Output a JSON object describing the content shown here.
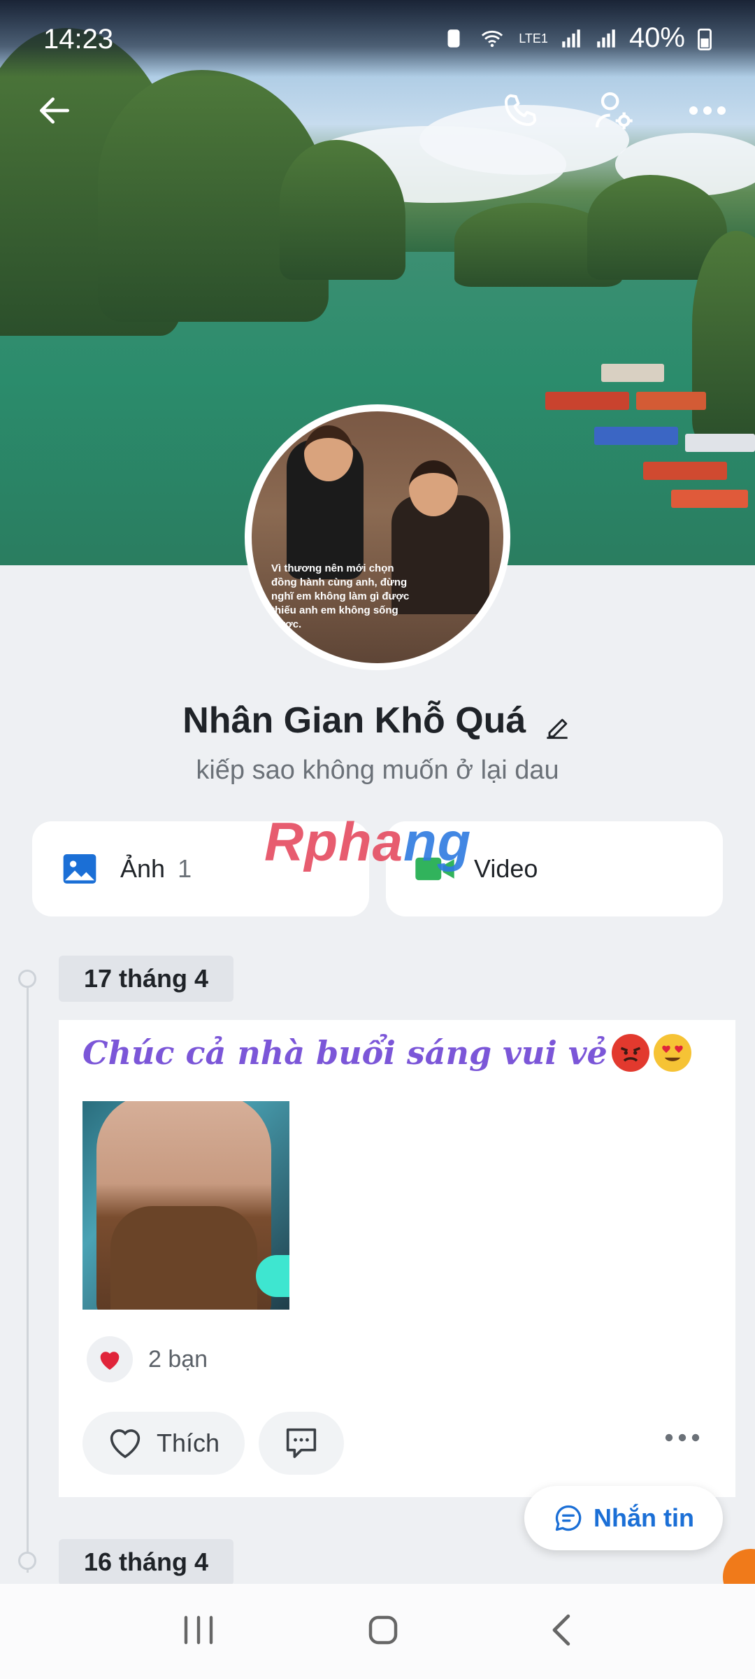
{
  "status_bar": {
    "time": "14:23",
    "network": "LTE1",
    "battery": "40%"
  },
  "header": {
    "back_icon": "arrow-left-icon",
    "call_icon": "phone-icon",
    "settings_icon": "user-settings-icon",
    "more_icon": "more-horizontal-icon"
  },
  "avatar_caption": "Vì thương nên mới chọn đồng hành cùng anh, đừng nghĩ em không làm gì được thiếu anh em không sống được.",
  "profile": {
    "name": "Nhân Gian Khỗ Quá",
    "bio": "kiếp sao không muốn ở lại dau"
  },
  "tiles": {
    "photos_label": "Ảnh",
    "photos_count": "1",
    "video_label": "Video"
  },
  "watermark": {
    "part1": "Rpha",
    "part2": "ng"
  },
  "timeline": {
    "date1": "17 tháng 4",
    "date2": "16 tháng 4"
  },
  "post": {
    "title": "Chúc cả nhà buổi sáng vui vẻ",
    "reactions_text": "2 bạn",
    "like_label": "Thích"
  },
  "message_button": {
    "label": "Nhắn tin"
  },
  "colors": {
    "accent_blue": "#1b6fd6",
    "title_purple": "#7b56d8",
    "heart_red": "#e0243a",
    "video_green": "#31b35c"
  }
}
